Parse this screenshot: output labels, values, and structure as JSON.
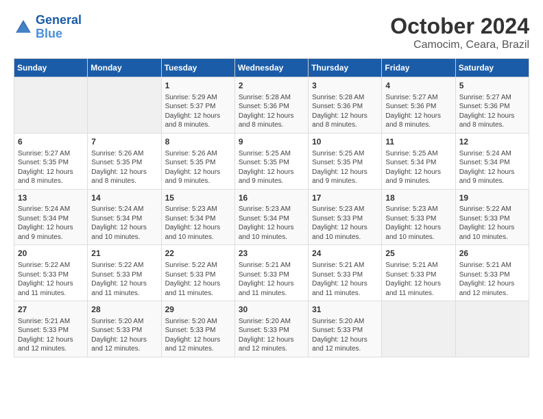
{
  "logo": {
    "line1": "General",
    "line2": "Blue"
  },
  "title": "October 2024",
  "location": "Camocim, Ceara, Brazil",
  "days_header": [
    "Sunday",
    "Monday",
    "Tuesday",
    "Wednesday",
    "Thursday",
    "Friday",
    "Saturday"
  ],
  "weeks": [
    [
      {
        "num": "",
        "sunrise": "",
        "sunset": "",
        "daylight": ""
      },
      {
        "num": "",
        "sunrise": "",
        "sunset": "",
        "daylight": ""
      },
      {
        "num": "1",
        "sunrise": "Sunrise: 5:29 AM",
        "sunset": "Sunset: 5:37 PM",
        "daylight": "Daylight: 12 hours and 8 minutes."
      },
      {
        "num": "2",
        "sunrise": "Sunrise: 5:28 AM",
        "sunset": "Sunset: 5:36 PM",
        "daylight": "Daylight: 12 hours and 8 minutes."
      },
      {
        "num": "3",
        "sunrise": "Sunrise: 5:28 AM",
        "sunset": "Sunset: 5:36 PM",
        "daylight": "Daylight: 12 hours and 8 minutes."
      },
      {
        "num": "4",
        "sunrise": "Sunrise: 5:27 AM",
        "sunset": "Sunset: 5:36 PM",
        "daylight": "Daylight: 12 hours and 8 minutes."
      },
      {
        "num": "5",
        "sunrise": "Sunrise: 5:27 AM",
        "sunset": "Sunset: 5:36 PM",
        "daylight": "Daylight: 12 hours and 8 minutes."
      }
    ],
    [
      {
        "num": "6",
        "sunrise": "Sunrise: 5:27 AM",
        "sunset": "Sunset: 5:35 PM",
        "daylight": "Daylight: 12 hours and 8 minutes."
      },
      {
        "num": "7",
        "sunrise": "Sunrise: 5:26 AM",
        "sunset": "Sunset: 5:35 PM",
        "daylight": "Daylight: 12 hours and 8 minutes."
      },
      {
        "num": "8",
        "sunrise": "Sunrise: 5:26 AM",
        "sunset": "Sunset: 5:35 PM",
        "daylight": "Daylight: 12 hours and 9 minutes."
      },
      {
        "num": "9",
        "sunrise": "Sunrise: 5:25 AM",
        "sunset": "Sunset: 5:35 PM",
        "daylight": "Daylight: 12 hours and 9 minutes."
      },
      {
        "num": "10",
        "sunrise": "Sunrise: 5:25 AM",
        "sunset": "Sunset: 5:35 PM",
        "daylight": "Daylight: 12 hours and 9 minutes."
      },
      {
        "num": "11",
        "sunrise": "Sunrise: 5:25 AM",
        "sunset": "Sunset: 5:34 PM",
        "daylight": "Daylight: 12 hours and 9 minutes."
      },
      {
        "num": "12",
        "sunrise": "Sunrise: 5:24 AM",
        "sunset": "Sunset: 5:34 PM",
        "daylight": "Daylight: 12 hours and 9 minutes."
      }
    ],
    [
      {
        "num": "13",
        "sunrise": "Sunrise: 5:24 AM",
        "sunset": "Sunset: 5:34 PM",
        "daylight": "Daylight: 12 hours and 9 minutes."
      },
      {
        "num": "14",
        "sunrise": "Sunrise: 5:24 AM",
        "sunset": "Sunset: 5:34 PM",
        "daylight": "Daylight: 12 hours and 10 minutes."
      },
      {
        "num": "15",
        "sunrise": "Sunrise: 5:23 AM",
        "sunset": "Sunset: 5:34 PM",
        "daylight": "Daylight: 12 hours and 10 minutes."
      },
      {
        "num": "16",
        "sunrise": "Sunrise: 5:23 AM",
        "sunset": "Sunset: 5:34 PM",
        "daylight": "Daylight: 12 hours and 10 minutes."
      },
      {
        "num": "17",
        "sunrise": "Sunrise: 5:23 AM",
        "sunset": "Sunset: 5:33 PM",
        "daylight": "Daylight: 12 hours and 10 minutes."
      },
      {
        "num": "18",
        "sunrise": "Sunrise: 5:23 AM",
        "sunset": "Sunset: 5:33 PM",
        "daylight": "Daylight: 12 hours and 10 minutes."
      },
      {
        "num": "19",
        "sunrise": "Sunrise: 5:22 AM",
        "sunset": "Sunset: 5:33 PM",
        "daylight": "Daylight: 12 hours and 10 minutes."
      }
    ],
    [
      {
        "num": "20",
        "sunrise": "Sunrise: 5:22 AM",
        "sunset": "Sunset: 5:33 PM",
        "daylight": "Daylight: 12 hours and 11 minutes."
      },
      {
        "num": "21",
        "sunrise": "Sunrise: 5:22 AM",
        "sunset": "Sunset: 5:33 PM",
        "daylight": "Daylight: 12 hours and 11 minutes."
      },
      {
        "num": "22",
        "sunrise": "Sunrise: 5:22 AM",
        "sunset": "Sunset: 5:33 PM",
        "daylight": "Daylight: 12 hours and 11 minutes."
      },
      {
        "num": "23",
        "sunrise": "Sunrise: 5:21 AM",
        "sunset": "Sunset: 5:33 PM",
        "daylight": "Daylight: 12 hours and 11 minutes."
      },
      {
        "num": "24",
        "sunrise": "Sunrise: 5:21 AM",
        "sunset": "Sunset: 5:33 PM",
        "daylight": "Daylight: 12 hours and 11 minutes."
      },
      {
        "num": "25",
        "sunrise": "Sunrise: 5:21 AM",
        "sunset": "Sunset: 5:33 PM",
        "daylight": "Daylight: 12 hours and 11 minutes."
      },
      {
        "num": "26",
        "sunrise": "Sunrise: 5:21 AM",
        "sunset": "Sunset: 5:33 PM",
        "daylight": "Daylight: 12 hours and 12 minutes."
      }
    ],
    [
      {
        "num": "27",
        "sunrise": "Sunrise: 5:21 AM",
        "sunset": "Sunset: 5:33 PM",
        "daylight": "Daylight: 12 hours and 12 minutes."
      },
      {
        "num": "28",
        "sunrise": "Sunrise: 5:20 AM",
        "sunset": "Sunset: 5:33 PM",
        "daylight": "Daylight: 12 hours and 12 minutes."
      },
      {
        "num": "29",
        "sunrise": "Sunrise: 5:20 AM",
        "sunset": "Sunset: 5:33 PM",
        "daylight": "Daylight: 12 hours and 12 minutes."
      },
      {
        "num": "30",
        "sunrise": "Sunrise: 5:20 AM",
        "sunset": "Sunset: 5:33 PM",
        "daylight": "Daylight: 12 hours and 12 minutes."
      },
      {
        "num": "31",
        "sunrise": "Sunrise: 5:20 AM",
        "sunset": "Sunset: 5:33 PM",
        "daylight": "Daylight: 12 hours and 12 minutes."
      },
      {
        "num": "",
        "sunrise": "",
        "sunset": "",
        "daylight": ""
      },
      {
        "num": "",
        "sunrise": "",
        "sunset": "",
        "daylight": ""
      }
    ]
  ]
}
